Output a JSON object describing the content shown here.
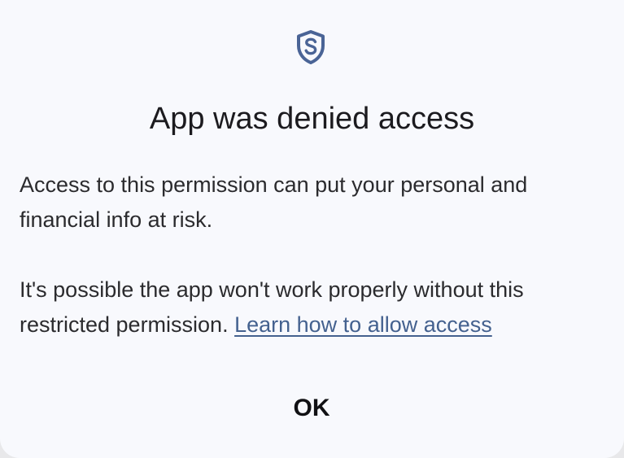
{
  "dialog": {
    "icon": "shield-icon",
    "title": "App was denied access",
    "paragraph_1": "Access to this permission can put your personal and financial info at risk.",
    "paragraph_2_text": "It's possible the app won't work properly without this restricted permission. ",
    "learn_link": "Learn how to allow access",
    "ok_label": "OK"
  },
  "colors": {
    "background": "#f8f9fd",
    "icon": "#4a6496",
    "link": "#44618f",
    "text": "#1c1b1f"
  }
}
